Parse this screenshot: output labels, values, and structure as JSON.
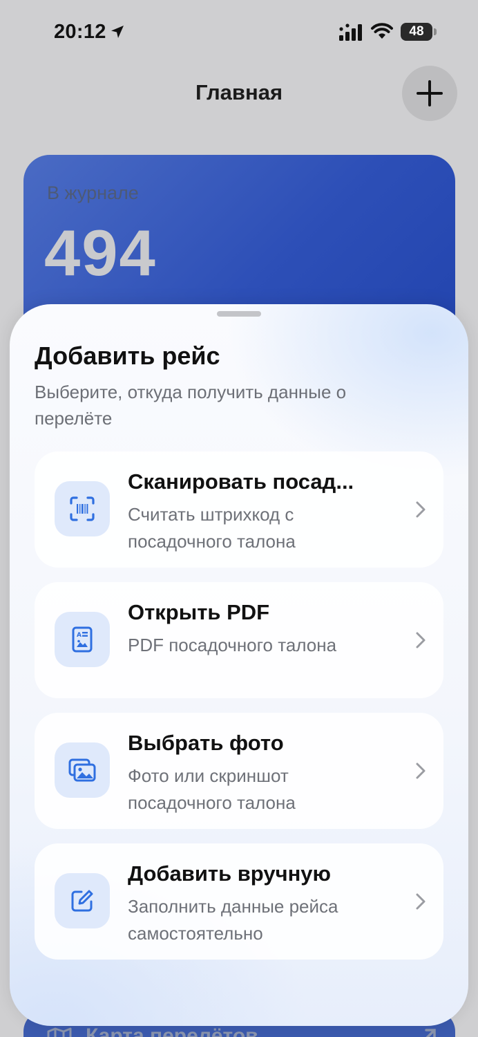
{
  "status_bar": {
    "time": "20:12",
    "battery": "48",
    "battery_level": 0.48
  },
  "header": {
    "title": "Главная",
    "add_button_icon": "plus-icon"
  },
  "journal_card": {
    "label": "В журнале",
    "count": "494"
  },
  "bottom_card": {
    "label": "Карта перелётов",
    "icon": "map-icon"
  },
  "sheet": {
    "title": "Добавить рейс",
    "subtitle": "Выберите, откуда получить данные о перелёте",
    "options": [
      {
        "title": "Сканировать посад...",
        "description": "Считать штрихкод с посадочного талона",
        "icon": "barcode-scan-icon"
      },
      {
        "title": "Открыть PDF",
        "description": "PDF посадочного талона",
        "icon": "pdf-document-icon"
      },
      {
        "title": "Выбрать фото",
        "description": "Фото или скриншот посадочного талона",
        "icon": "photo-gallery-icon"
      },
      {
        "title": "Добавить вручную",
        "description": "Заполнить данные рейса самостоятельно",
        "icon": "edit-icon"
      }
    ]
  },
  "colors": {
    "accent": "#2f6fe0",
    "icon_bg": "#dfe9fb",
    "card_blue": "#2d4fb7"
  }
}
